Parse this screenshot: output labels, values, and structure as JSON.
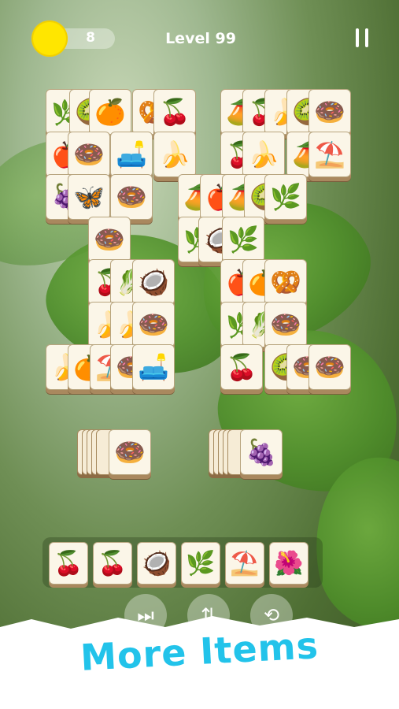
{
  "hud": {
    "coins": "8",
    "level_label": "Level 99"
  },
  "board": {
    "tiles": [
      {
        "icon": "🌿"
      },
      {
        "icon": "🥝"
      },
      {
        "icon": "🍊"
      },
      {
        "icon": "🥨"
      },
      {
        "icon": "🍒"
      },
      {
        "icon": "🍎"
      },
      {
        "icon": "🍩"
      },
      {
        "icon": "🛋️"
      },
      {
        "icon": "🍌"
      },
      {
        "icon": "🍇"
      },
      {
        "icon": "🦋"
      },
      {
        "icon": "🍩"
      },
      {
        "icon": "🍩"
      },
      {
        "icon": "🍒"
      },
      {
        "icon": "🥬"
      },
      {
        "icon": "🥥"
      },
      {
        "icon": "🍌"
      },
      {
        "icon": "🍌"
      },
      {
        "icon": "🍩"
      },
      {
        "icon": "🍌"
      },
      {
        "icon": "🍊"
      },
      {
        "icon": "⛱️"
      },
      {
        "icon": "🍩"
      },
      {
        "icon": "🛋️"
      },
      {
        "icon": "🥭"
      },
      {
        "icon": "🍒"
      },
      {
        "icon": "🍌"
      },
      {
        "icon": "🥝"
      },
      {
        "icon": "🍩"
      },
      {
        "icon": "🍒"
      },
      {
        "icon": "🍌"
      },
      {
        "icon": "🥭"
      },
      {
        "icon": "⛱️"
      },
      {
        "icon": "🥭"
      },
      {
        "icon": "🍎"
      },
      {
        "icon": "🥭"
      },
      {
        "icon": "🥝"
      },
      {
        "icon": "🌿"
      },
      {
        "icon": "🌿"
      },
      {
        "icon": "🥥"
      },
      {
        "icon": "🌿"
      },
      {
        "icon": "🍎"
      },
      {
        "icon": "🍊"
      },
      {
        "icon": "🥨"
      },
      {
        "icon": "🌿"
      },
      {
        "icon": "🥬"
      },
      {
        "icon": "🍩"
      },
      {
        "icon": "🍒"
      },
      {
        "icon": "🥝"
      },
      {
        "icon": "🍩"
      },
      {
        "icon": "🍩"
      }
    ],
    "stack_left_top": "🍩",
    "stack_right_top": "🍇"
  },
  "tray": {
    "slots": [
      {
        "icon": "🍒"
      },
      {
        "icon": "🍒"
      },
      {
        "icon": "🥥"
      },
      {
        "icon": "🌿"
      },
      {
        "icon": "⛱️"
      },
      {
        "icon": "🌺"
      }
    ]
  },
  "tools": [
    {
      "icon": "⏭"
    },
    {
      "icon": "⇅"
    },
    {
      "icon": "⟲"
    }
  ],
  "banner": {
    "text": "More Items"
  },
  "colors": {
    "coin": "#ffe600",
    "banner_text": "#22c3ea",
    "tile_face": "#fbf6e8",
    "tile_edge": "#a9885e"
  }
}
